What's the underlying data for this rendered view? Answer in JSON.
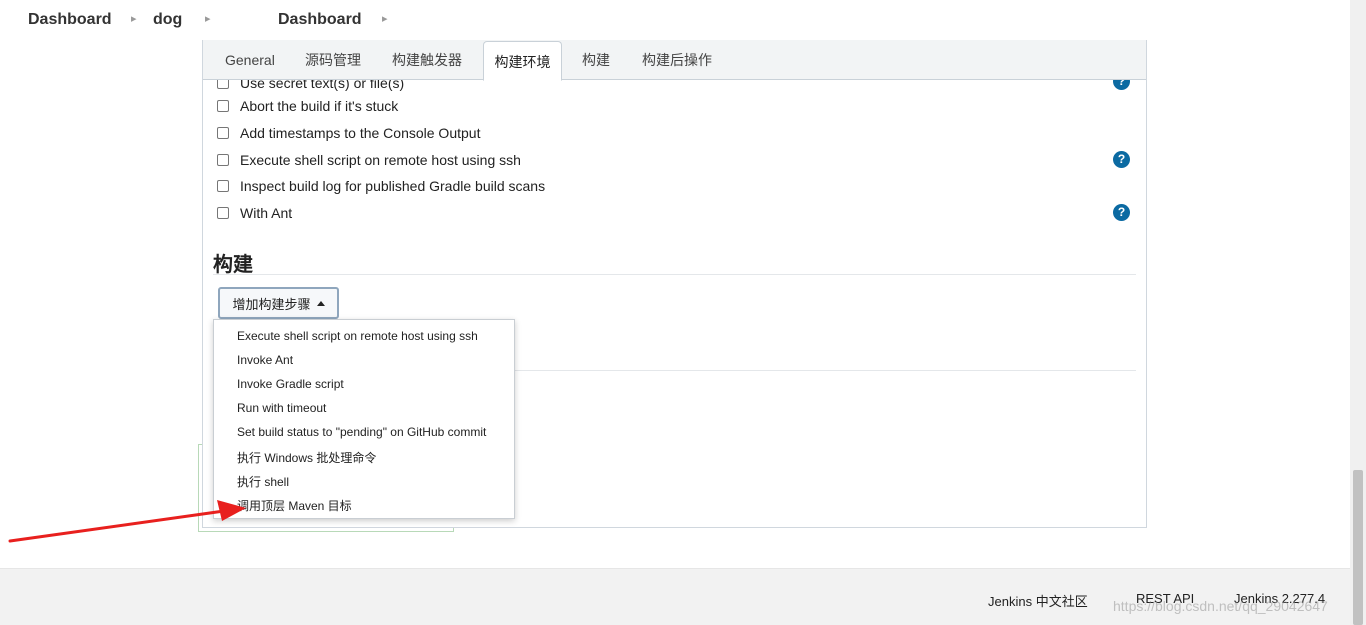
{
  "breadcrumb": {
    "items": [
      {
        "label": "Dashboard"
      },
      {
        "label": "dog"
      },
      {
        "label": "Dashboard"
      }
    ]
  },
  "tabs": [
    {
      "label": "General"
    },
    {
      "label": "源码管理"
    },
    {
      "label": "构建触发器"
    },
    {
      "label": "构建环境",
      "active": true
    },
    {
      "label": "构建"
    },
    {
      "label": "构建后操作"
    }
  ],
  "build_env": {
    "options": [
      {
        "label": "Use secret text(s) or file(s)",
        "checked": false
      },
      {
        "label": "Abort the build if it's stuck",
        "checked": false
      },
      {
        "label": "Add timestamps to the Console Output",
        "checked": false
      },
      {
        "label": "Execute shell script on remote host using ssh",
        "checked": false
      },
      {
        "label": "Inspect build log for published Gradle build scans",
        "checked": false
      },
      {
        "label": "With Ant",
        "checked": false
      }
    ],
    "help_glyph": "?"
  },
  "build_section": {
    "title": "构建",
    "add_step_label": "增加构建步骤"
  },
  "dropdown": {
    "items": [
      {
        "label": "Execute shell script on remote host using ssh"
      },
      {
        "label": "Invoke Ant"
      },
      {
        "label": "Invoke Gradle script"
      },
      {
        "label": "Run with timeout"
      },
      {
        "label": "Set build status to \"pending\" on GitHub commit"
      },
      {
        "label": "执行 Windows 批处理命令"
      },
      {
        "label": "执行 shell"
      },
      {
        "label": "调用顶层 Maven 目标"
      }
    ]
  },
  "footer": {
    "community_label": "Jenkins 中文社区",
    "rest_api_label": "REST API",
    "version_label": "Jenkins 2.277.4",
    "watermark": "https://blog.csdn.net/qq_29042647"
  },
  "colors": {
    "accent": "#0b6aa2",
    "arrow": "#e8201e"
  }
}
